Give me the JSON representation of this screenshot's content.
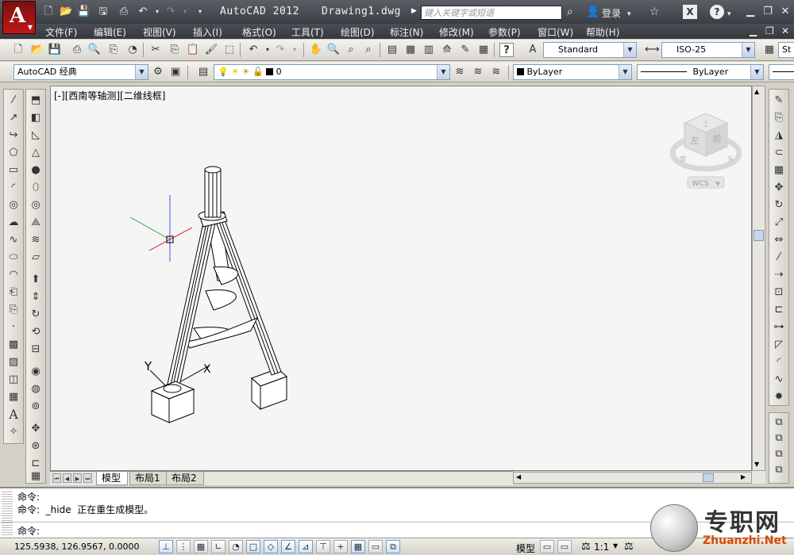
{
  "titlebar": {
    "app_title": "AutoCAD 2012",
    "doc_title": "Drawing1.dwg",
    "search_placeholder": "键入关键字或短语",
    "signin_label": "登录",
    "exchange_label": "X",
    "help_label": "?"
  },
  "menu": {
    "items": [
      "文件(F)",
      "编辑(E)",
      "视图(V)",
      "插入(I)",
      "格式(O)",
      "工具(T)",
      "绘图(D)",
      "标注(N)",
      "修改(M)",
      "参数(P)",
      "窗口(W)",
      "帮助(H)"
    ]
  },
  "styles_toolbar": {
    "text_style": "Standard",
    "dim_style": "ISO-25",
    "table_style_partial": "St"
  },
  "layers_toolbar": {
    "workspace": "AutoCAD 经典",
    "layer": "0",
    "color": "ByLayer",
    "linetype": "ByLayer"
  },
  "viewport": {
    "label": "[-][西南等轴测][二维线框]",
    "viewcube_top": "上",
    "viewcube_left": "左",
    "viewcube_front": "前",
    "viewcube_south": "南",
    "viewcube_east": "东",
    "wcs_label": "WCS",
    "ucs_x": "X",
    "ucs_y": "Y"
  },
  "layout_tabs": [
    "模型",
    "布局1",
    "布局2"
  ],
  "command": {
    "line1": "命令:",
    "line2": "命令:  _hide  正在重生成模型。",
    "prompt": "命令:"
  },
  "status": {
    "coords": "125.5938, 126.9567, 0.0000",
    "model": "模型",
    "scale": "1:1"
  },
  "watermark": {
    "cn": "专职网",
    "en": "Zhuanzhi.Net"
  },
  "colors": {
    "title_bg": "#3a3e44",
    "viewport_bg": "#f5f5f5",
    "layer_color_swatch": "#000000"
  }
}
